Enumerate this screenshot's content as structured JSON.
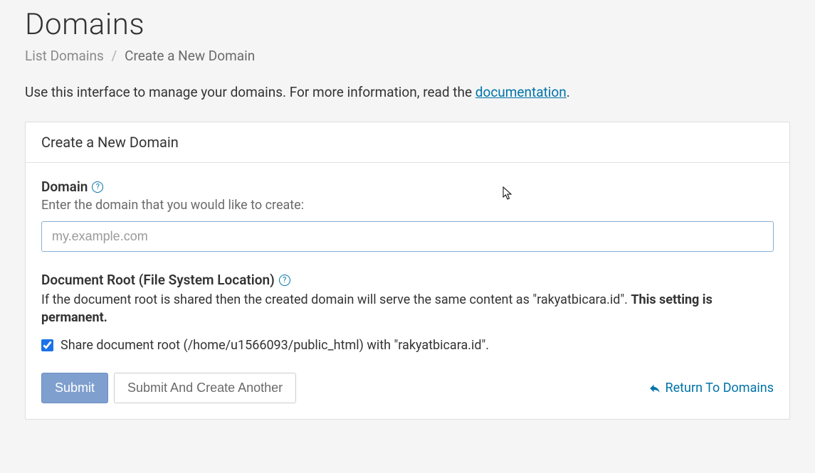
{
  "page": {
    "title": "Domains"
  },
  "breadcrumb": {
    "list": "List Domains",
    "current": "Create a New Domain"
  },
  "intro": {
    "text_before": "Use this interface to manage your domains. For more information, read the ",
    "link": "documentation",
    "text_after": "."
  },
  "panel": {
    "header": "Create a New Domain"
  },
  "domain_field": {
    "label": "Domain",
    "hint": "Enter the domain that you would like to create:",
    "placeholder": "my.example.com",
    "value": ""
  },
  "docroot": {
    "label": "Document Root (File System Location)",
    "hint_before": "If the document root is shared then the created domain will serve the same content as \"rakyatbicara.id\". ",
    "hint_bold": "This setting is permanent.",
    "checkbox_label": "Share document root (/home/u1566093/public_html) with \"rakyatbicara.id\".",
    "checked": true
  },
  "actions": {
    "submit": "Submit",
    "submit_another": "Submit And Create Another",
    "return": "Return To Domains"
  }
}
